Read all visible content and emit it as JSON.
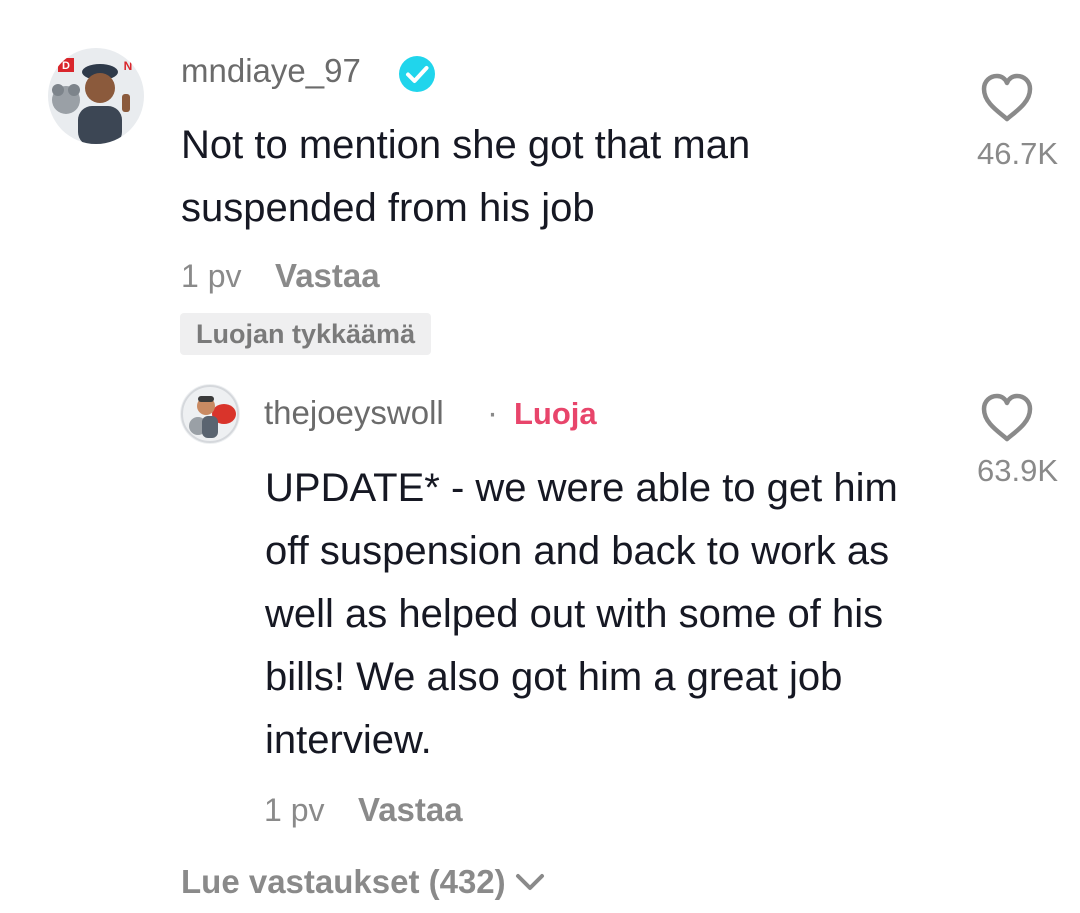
{
  "comment": {
    "username": "mndiaye_97",
    "verified_icon": "verified-badge-icon",
    "text": "Not to mention she got that man suspended from his job",
    "time": "1 pv",
    "reply_label": "Vastaa",
    "creator_liked_label": "Luojan tykkäämä",
    "like_count": "46.7K",
    "avatar_letters": [
      "D",
      "N"
    ]
  },
  "reply": {
    "username": "thejoeyswoll",
    "separator": "·",
    "creator_label": "Luoja",
    "text": "UPDATE* - we were able to get him off suspension and back to work as well as helped out with some of his bills! We also got him a great job interview.",
    "time": "1 pv",
    "reply_label": "Vastaa",
    "like_count": "63.9K"
  },
  "view_replies_label": "Lue vastaukset (432)",
  "colors": {
    "creator_accent": "#e8456b",
    "verified": "#20d5ec",
    "muted_text": "#8a8a8a",
    "text": "#161823"
  }
}
